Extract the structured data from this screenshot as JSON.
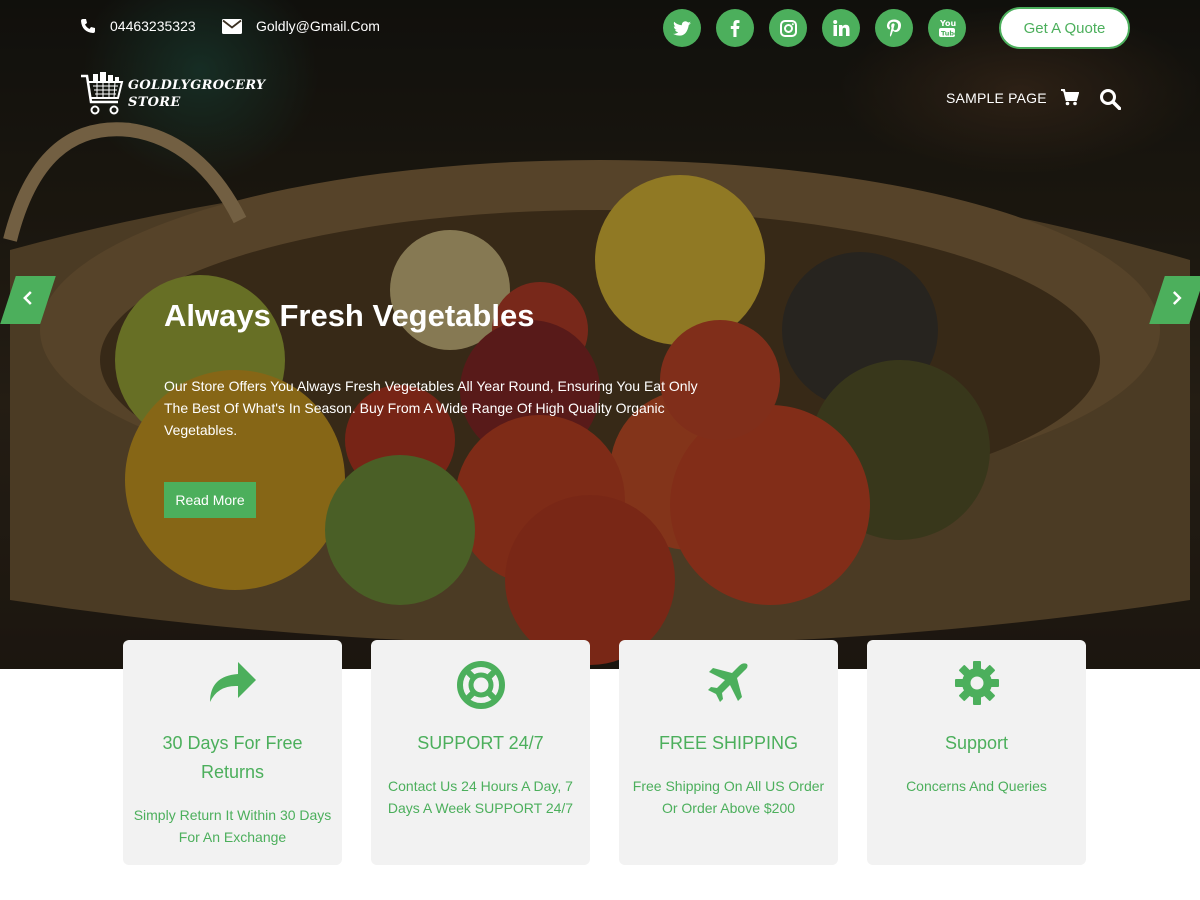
{
  "topbar": {
    "phone": "04463235323",
    "email": "Goldly@Gmail.Com",
    "socials": [
      {
        "icon": "twitter-icon"
      },
      {
        "icon": "facebook-icon"
      },
      {
        "icon": "instagram-icon"
      },
      {
        "icon": "linkedin-icon"
      },
      {
        "icon": "pinterest-icon"
      },
      {
        "icon": "youtube-icon"
      }
    ],
    "quote_button": "Get A Quote"
  },
  "nav": {
    "logo_line1": "GOLDLYGROCERY",
    "logo_line2": "STORE",
    "links": [
      "SAMPLE PAGE"
    ]
  },
  "slider": {
    "title": "Always Fresh Vegetables",
    "text": "Our Store Offers You Always Fresh Vegetables All Year Round, Ensuring You Eat Only The Best Of What's In Season. Buy From A Wide Range Of High Quality Organic Vegetables.",
    "button": "Read More"
  },
  "features": [
    {
      "icon": "return-arrow-icon",
      "title": "30 Days For Free Returns",
      "desc": "Simply Return It Within 30 Days For An Exchange"
    },
    {
      "icon": "lifebuoy-icon",
      "title": "SUPPORT 24/7",
      "desc": "Contact Us 24 Hours A Day, 7 Days A Week SUPPORT 24/7"
    },
    {
      "icon": "plane-icon",
      "title": "FREE SHIPPING",
      "desc": "Free Shipping On All US Order Or Order Above $200"
    },
    {
      "icon": "gear-icon",
      "title": "Support",
      "desc": "Concerns And Queries"
    }
  ],
  "colors": {
    "accent": "#4caf5c",
    "card_bg": "#f2f2f2"
  }
}
